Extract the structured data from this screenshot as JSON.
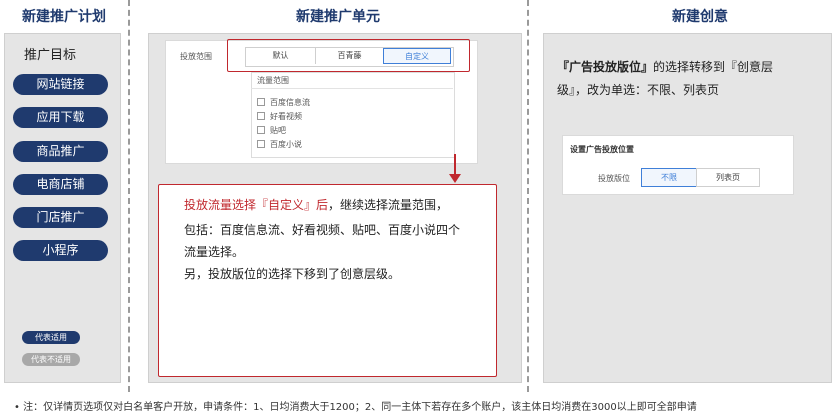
{
  "columns": {
    "plan_title": "新建推广计划",
    "unit_title": "新建推广单元",
    "creative_title": "新建创意"
  },
  "plan": {
    "goal_title": "推广目标",
    "goals": [
      "网站链接",
      "应用下载",
      "商品推广",
      "电商店铺",
      "门店推广",
      "小程序"
    ],
    "legend": {
      "applicable": "代表适用",
      "not_applicable": "代表不适用"
    }
  },
  "unit": {
    "placement_label": "投放范围",
    "segments": [
      "默认",
      "百青藤",
      "自定义"
    ],
    "selected_segment": "自定义",
    "traffic_label": "流量范围",
    "traffic_options": [
      "百度信息流",
      "好看视频",
      "贴吧",
      "百度小说"
    ],
    "note": {
      "line1_red": "投放流量选择『自定义』后",
      "line1_rest": "，继续选择流量范围，",
      "line2": "包括：百度信息流、好看视频、贴吧、百度小说四个",
      "line3": "流量选择。",
      "line4": "另，投放版位的选择下移到了创意层级。"
    }
  },
  "creative": {
    "desc_bold": "『广告投放版位』",
    "desc_line1_rest": "的选择转移到『创意层",
    "desc_line2": "级』，改为单选：不限、列表页",
    "settings_title": "设置广告投放位置",
    "position_label": "投放版位",
    "options": [
      "不限",
      "列表页"
    ],
    "selected_option": "不限"
  },
  "footnote": "•   注：仅详情页选项仅对白名单客户开放，申请条件：1、日均消费大于1200；2、同一主体下若存在多个账户，该主体日均消费在3000以上即可全部申请",
  "colors": {
    "navy": "#1f3a6e",
    "red": "#c0282e",
    "accent_blue": "#3f7fd8",
    "panel_gray": "#e5e5e5"
  }
}
